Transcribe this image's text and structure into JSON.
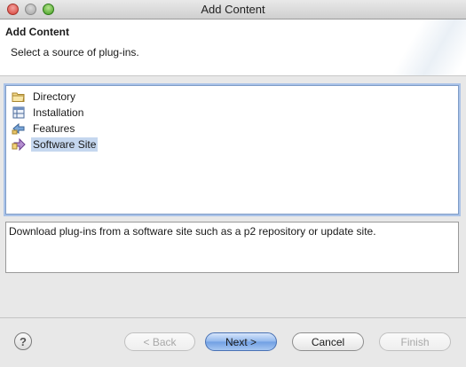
{
  "window": {
    "title": "Add Content"
  },
  "header": {
    "title": "Add Content",
    "description": "Select a source of plug-ins."
  },
  "sources": [
    {
      "label": "Directory",
      "icon": "folder-icon",
      "selected": false
    },
    {
      "label": "Installation",
      "icon": "installation-icon",
      "selected": false
    },
    {
      "label": "Features",
      "icon": "features-icon",
      "selected": false
    },
    {
      "label": "Software Site",
      "icon": "software-site-icon",
      "selected": true
    }
  ],
  "description_text": "Download plug-ins from a software site such as a p2 repository or update site.",
  "buttons": {
    "help": "?",
    "back": "< Back",
    "next": "Next >",
    "cancel": "Cancel",
    "finish": "Finish"
  },
  "colors": {
    "selection": "#c5d7ef",
    "focus_ring": "#aac3e8",
    "primary_button": "#6f9fe3"
  }
}
